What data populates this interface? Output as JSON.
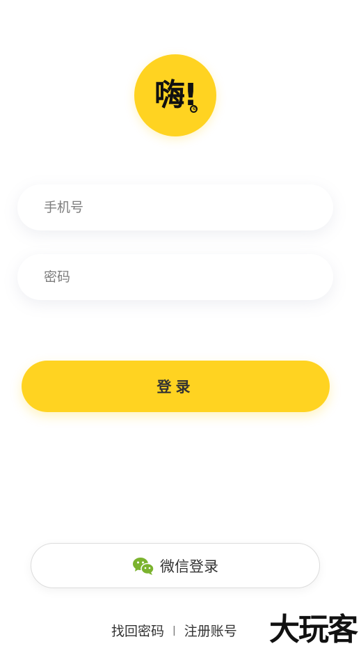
{
  "logo": {
    "text": "嗨!",
    "mark": "©"
  },
  "form": {
    "phone_placeholder": "手机号",
    "password_placeholder": "密码",
    "login_label": "登录"
  },
  "wechat": {
    "label": "微信登录",
    "icon": "wechat-icon"
  },
  "links": {
    "forgot_password": "找回密码",
    "separator": "|",
    "register": "注册账号"
  },
  "watermark": "大玩客",
  "colors": {
    "brand_yellow": "#FFD321",
    "wechat_green": "#7BB32E"
  }
}
